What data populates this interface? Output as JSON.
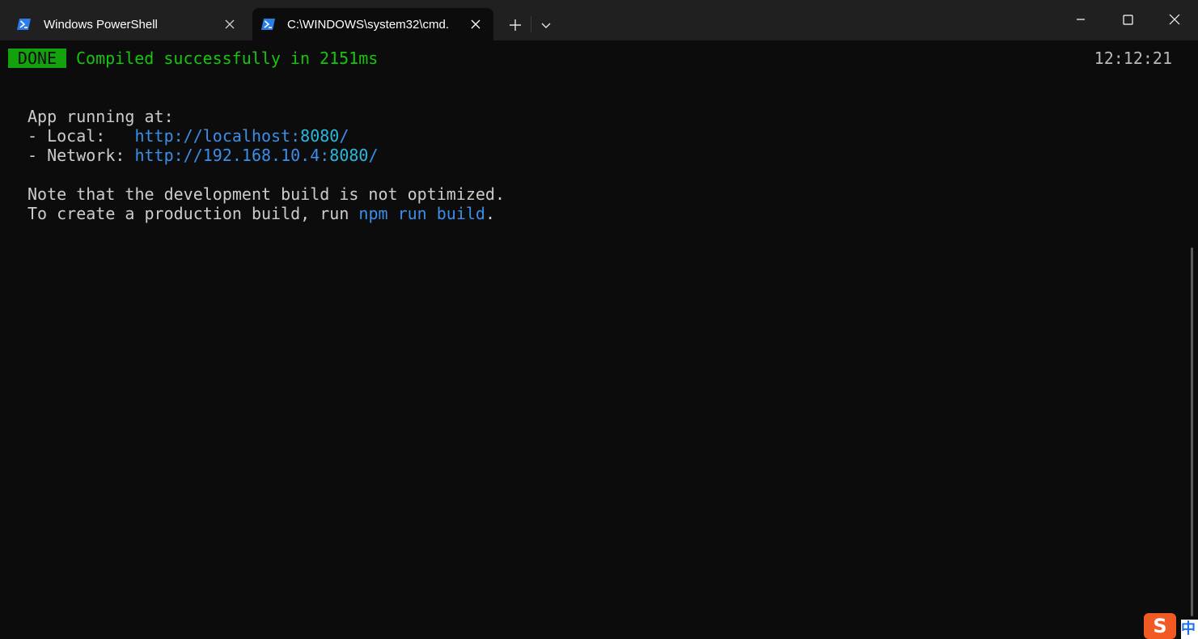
{
  "tabs": [
    {
      "label": "Windows PowerShell",
      "icon": "powershell-icon",
      "active": false
    },
    {
      "label": "C:\\WINDOWS\\system32\\cmd.",
      "icon": "powershell-icon",
      "active": true
    }
  ],
  "terminal": {
    "badge": "DONE",
    "compiled": "Compiled successfully in 2151ms",
    "time": "12:12:21",
    "running_at": "App running at:",
    "local_prefix": "- Local:   ",
    "local_url": "http://localhost:",
    "local_port": "8080",
    "local_slash": "/",
    "network_prefix": "- Network: ",
    "network_url": "http://192.168.10.4:",
    "network_port": "8080",
    "network_slash": "/",
    "note_line": "Note that the development build is not optimized.",
    "create_prefix": "To create a production build, run ",
    "create_cmd": "npm run build",
    "create_suffix": "."
  },
  "ime": {
    "logo": "S",
    "mode": "中"
  },
  "colors": {
    "titlebar": "#202020",
    "terminal_bg": "#0c0c0c",
    "badge_green": "#13a10e",
    "text_green": "#16c60c",
    "link_blue": "#3b8eea",
    "port_cyan": "#29b8db"
  }
}
